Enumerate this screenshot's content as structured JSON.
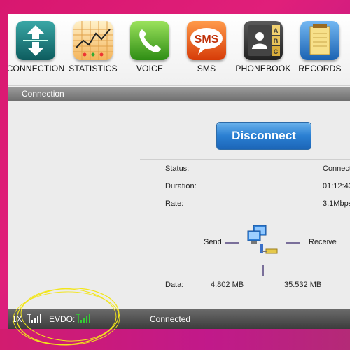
{
  "toolbar": {
    "items": [
      {
        "label": "CONNECTION",
        "icon": "connection-arrows-icon"
      },
      {
        "label": "STATISTICS",
        "icon": "statistics-chart-icon"
      },
      {
        "label": "VOICE",
        "icon": "phone-handset-icon"
      },
      {
        "label": "SMS",
        "icon": "sms-bubble-icon"
      },
      {
        "label": "PHONEBOOK",
        "icon": "phonebook-icon"
      },
      {
        "label": "RECORDS",
        "icon": "records-notepad-icon"
      }
    ],
    "sms_icon_text": "SMS",
    "phonebook_tabs": [
      "A",
      "B",
      "C"
    ]
  },
  "section": {
    "title": "Connection"
  },
  "connection": {
    "button_label": "Disconnect",
    "status_label": "Status:",
    "status_value": "Connect",
    "duration_label": "Duration:",
    "duration_value": "01:12:43",
    "rate_label": "Rate:",
    "rate_value": "3.1Mbps"
  },
  "network": {
    "send_label": "Send",
    "receive_label": "Receive",
    "data_label": "Data:",
    "send_value": "4.802 MB",
    "receive_value": "35.532 MB"
  },
  "statusbar": {
    "mode_1x": "1X",
    "evdo_label": "EVDO:",
    "connection_status": "Connected",
    "signal_color_1x": "#ffffff",
    "signal_color_evdo": "#33cc33"
  },
  "colors": {
    "accent_button": "#2a7fd2",
    "annotation": "#f2e51a"
  }
}
